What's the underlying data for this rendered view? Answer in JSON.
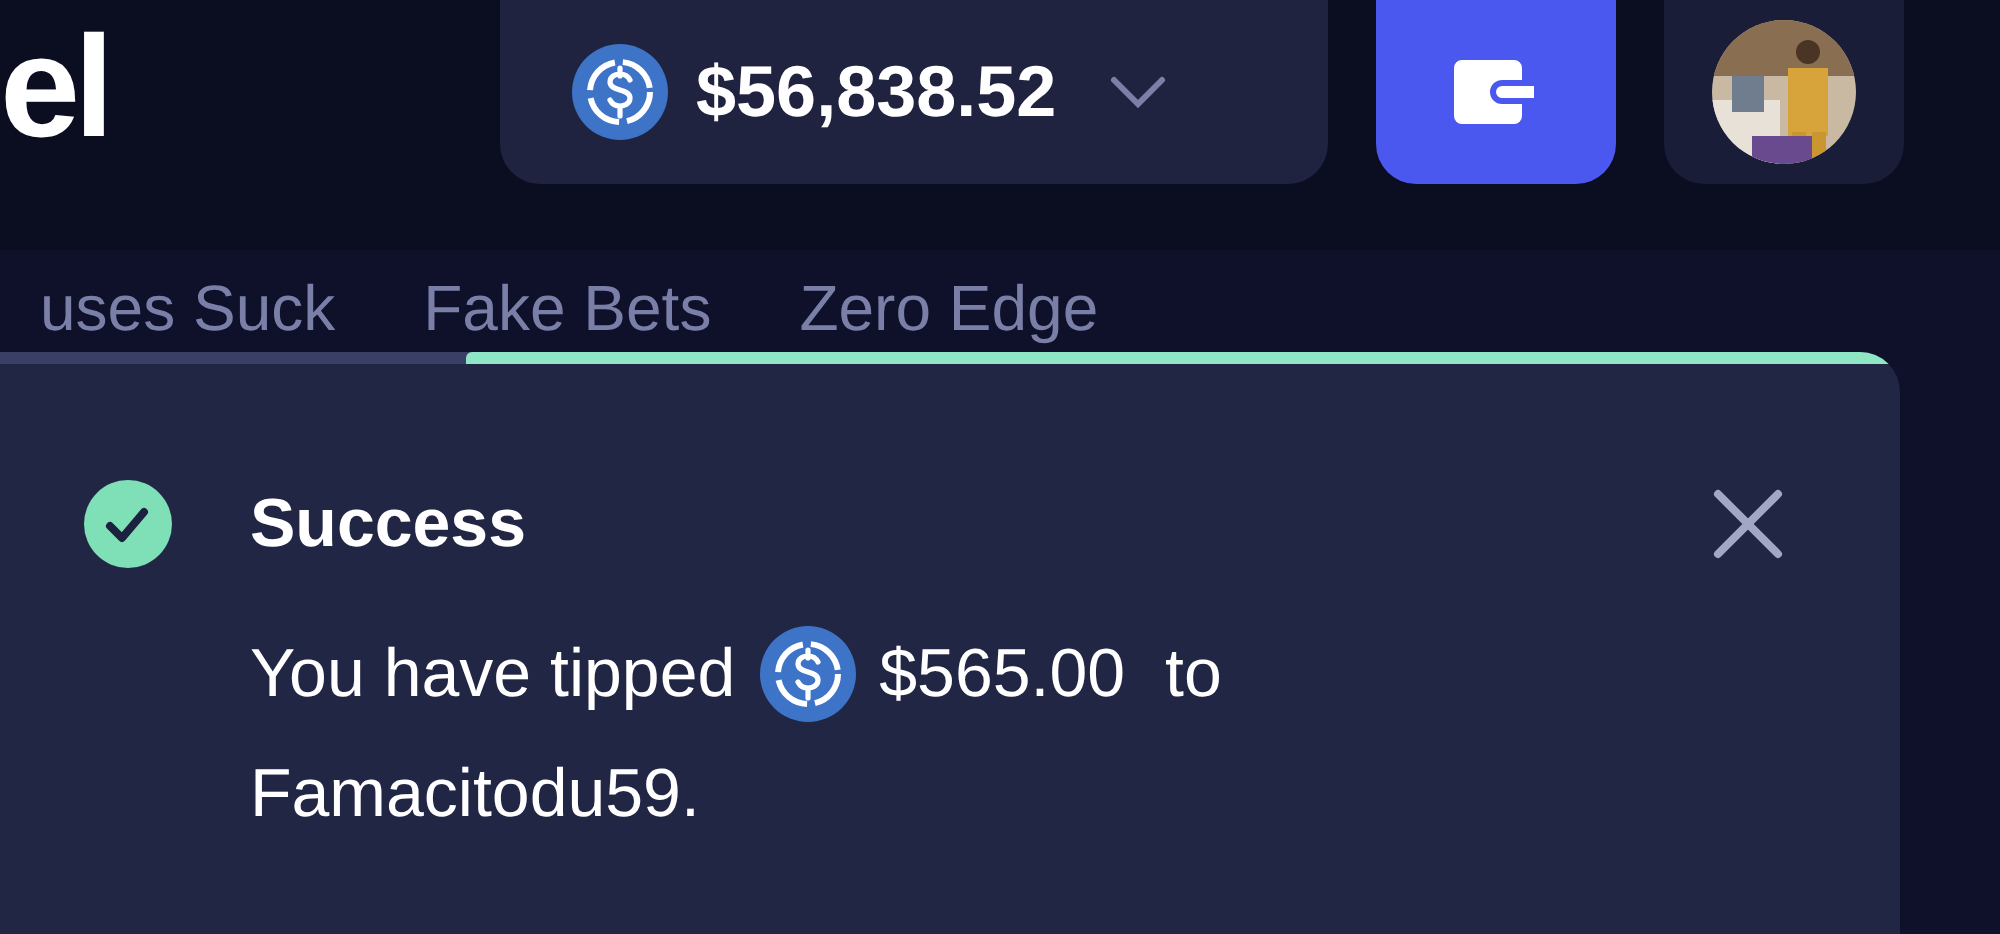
{
  "logo": {
    "text": "el"
  },
  "balance": {
    "amount": "$56,838.52"
  },
  "nav": {
    "items": [
      {
        "label": "uses Suck"
      },
      {
        "label": "Fake Bets"
      },
      {
        "label": "Zero Edge"
      }
    ]
  },
  "toast": {
    "title": "Success",
    "level": 0.755,
    "message": [
      {
        "kind": "text",
        "text": "You have tipped"
      },
      {
        "kind": "coin"
      },
      {
        "kind": "text",
        "text": "$565.00"
      },
      {
        "kind": "text",
        "text": "to"
      },
      {
        "kind": "text",
        "text": "Famacitodu59."
      }
    ]
  }
}
